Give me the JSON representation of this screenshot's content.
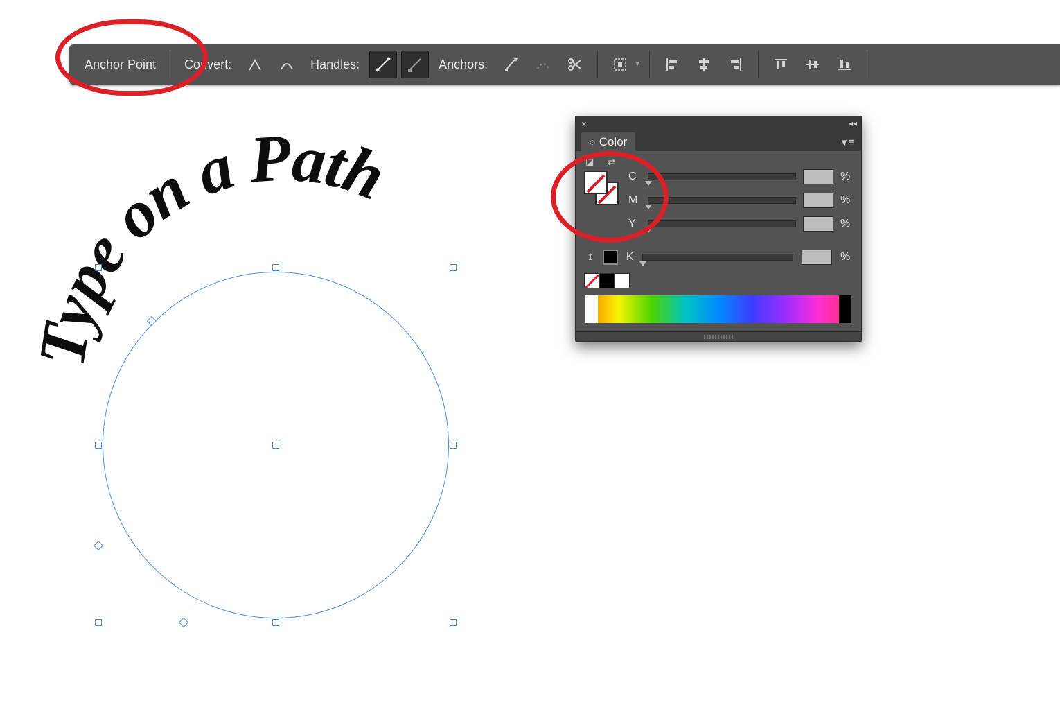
{
  "control_bar": {
    "tool_label": "Anchor Point",
    "convert_label": "Convert:",
    "handles_label": "Handles:",
    "anchors_label": "Anchors:"
  },
  "canvas": {
    "path_text": "Type on a Path",
    "selection_shape": "circle"
  },
  "color_panel": {
    "title": "Color",
    "channels": [
      {
        "label": "C",
        "value": ""
      },
      {
        "label": "M",
        "value": ""
      },
      {
        "label": "Y",
        "value": ""
      },
      {
        "label": "K",
        "value": ""
      }
    ],
    "percent_suffix": "%",
    "fill": "none",
    "stroke": "none"
  },
  "annotations": {
    "circle_1": "highlight-anchor-point-label",
    "circle_2": "highlight-color-swatches"
  }
}
